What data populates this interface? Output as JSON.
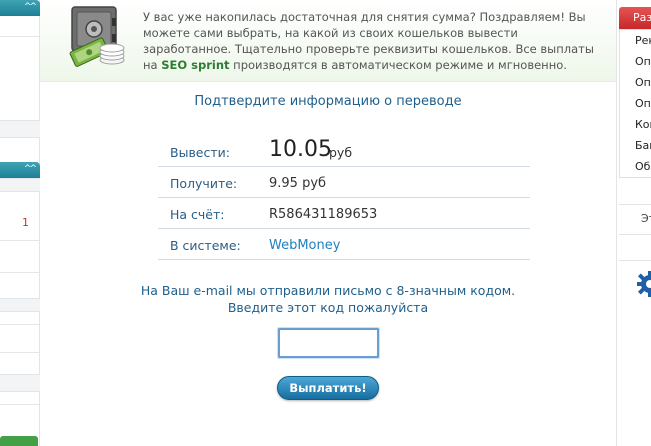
{
  "left_sidebar": {
    "collapse_glyph": "^^",
    "counter": "1"
  },
  "banner": {
    "icon": "safe-money-icon",
    "text_before": "У вас уже накопилась достаточная для снятия сумма? Поздравляем! Вы можете сами выбрать, на какой из своих кошельков вывести заработанное. Тщательно проверьте реквизиты кошельков. Все выплаты на ",
    "brand": "SEO sprint",
    "text_after": " производятся в автоматическом режиме и мгновенно."
  },
  "confirm_title": "Подтвердите информацию о переводе",
  "transfer": {
    "withdraw_label": "Вывести:",
    "withdraw_amount": "10.05",
    "withdraw_currency": "руб",
    "receive_label": "Получите:",
    "receive_value": "9.95 руб",
    "account_label": "На счёт:",
    "account_value": "R586431189653",
    "system_label": "В системе:",
    "system_value": "WebMoney"
  },
  "notice": {
    "line1": "На Ваш e-mail мы отправили письмо с 8-значным кодом.",
    "line2": "Введите этот код пожалуйста"
  },
  "code_field": {
    "value": "",
    "placeholder": ""
  },
  "pay_button": "Выплатить!",
  "right_sidebar": {
    "header": "Раз",
    "items": [
      "Рек",
      "Опл",
      "Опл",
      "Опл",
      "Кон",
      "Бан",
      "Обл"
    ],
    "extra": "Эт",
    "gear_icon": "gear-icon"
  },
  "colors": {
    "accent_blue": "#1f5f8b",
    "brand_green": "#2e7d32",
    "button_blue": "#176e9f",
    "sidebar_teal": "#1f7f95",
    "sidebar_red": "#c62828"
  }
}
